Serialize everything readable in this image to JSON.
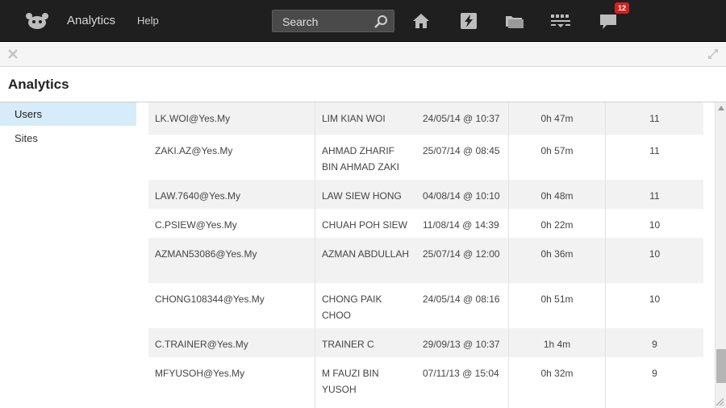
{
  "header": {
    "app_name": "Analytics",
    "help_label": "Help",
    "search_placeholder": "Search",
    "notification_count": "12",
    "icons": [
      "home-icon",
      "flash-icon",
      "folder-icon",
      "dashboard-icon",
      "chat-icon"
    ]
  },
  "page": {
    "title": "Analytics"
  },
  "sidebar": {
    "items": [
      {
        "label": "Users",
        "active": true
      },
      {
        "label": "Sites",
        "active": false
      }
    ]
  },
  "table": {
    "rows": [
      {
        "email": "LK.WOI@Yes.My",
        "name": "LIM KIAN WOI",
        "last_access": "24/05/14 @ 10:37",
        "duration": "0h 47m",
        "count": "11"
      },
      {
        "email": "ZAKI.AZ@Yes.My",
        "name": "AHMAD ZHARIF BIN AHMAD ZAKI",
        "last_access": "25/07/14 @ 08:45",
        "duration": "0h 57m",
        "count": "11"
      },
      {
        "email": "LAW.7640@Yes.My",
        "name": "LAW SIEW HONG",
        "last_access": "04/08/14 @ 10:10",
        "duration": "0h 48m",
        "count": "11"
      },
      {
        "email": "C.PSIEW@Yes.My",
        "name": "CHUAH POH SIEW",
        "last_access": "11/08/14 @ 14:39",
        "duration": "0h 22m",
        "count": "10"
      },
      {
        "email": "AZMAN53086@Yes.My",
        "name": "AZMAN ABDULLAH",
        "last_access": "25/07/14 @ 12:00",
        "duration": "0h 36m",
        "count": "10"
      },
      {
        "email": "CHONG108344@Yes.My",
        "name": "CHONG PAIK CHOO",
        "last_access": "24/05/14 @ 08:16",
        "duration": "0h 51m",
        "count": "10"
      },
      {
        "email": "C.TRAINER@Yes.My",
        "name": "TRAINER C",
        "last_access": "29/09/13 @ 10:37",
        "duration": "1h 4m",
        "count": "9"
      },
      {
        "email": "MFYUSOH@Yes.My",
        "name": "M FAUZI BIN YUSOH",
        "last_access": "07/11/13 @ 15:04",
        "duration": "0h 32m",
        "count": "9"
      }
    ]
  },
  "colors": {
    "topbar": "#1f1f1f",
    "active_sidebar": "#d6ecf8",
    "badge": "#d42020"
  }
}
